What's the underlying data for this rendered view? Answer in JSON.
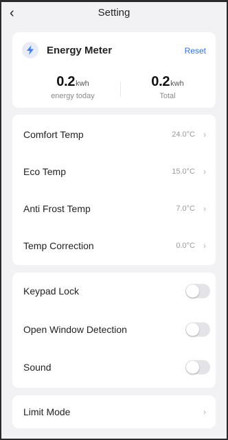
{
  "header": {
    "back_icon": "chevron-left-icon",
    "title": "Setting"
  },
  "energy": {
    "icon": "lightning-bolt-icon",
    "name": "Energy Meter",
    "reset_label": "Reset",
    "today": {
      "value": "0.2",
      "unit": "kwh",
      "label": "energy today"
    },
    "total": {
      "value": "0.2",
      "unit": "kwh",
      "label": "Total"
    }
  },
  "temps": [
    {
      "label": "Comfort Temp",
      "value": "24.0°C"
    },
    {
      "label": "Eco Temp",
      "value": "15.0°C"
    },
    {
      "label": "Anti Frost Temp",
      "value": "7.0°C"
    },
    {
      "label": "Temp Correction",
      "value": "0.0°C"
    }
  ],
  "toggles": [
    {
      "label": "Keypad Lock",
      "on": false
    },
    {
      "label": "Open Window Detection",
      "on": false
    },
    {
      "label": "Sound",
      "on": false
    }
  ],
  "limit": {
    "label": "Limit Mode"
  },
  "colors": {
    "accent": "#2f6ff0",
    "bolt": "#3b7bff",
    "background": "#f2f2f4"
  }
}
